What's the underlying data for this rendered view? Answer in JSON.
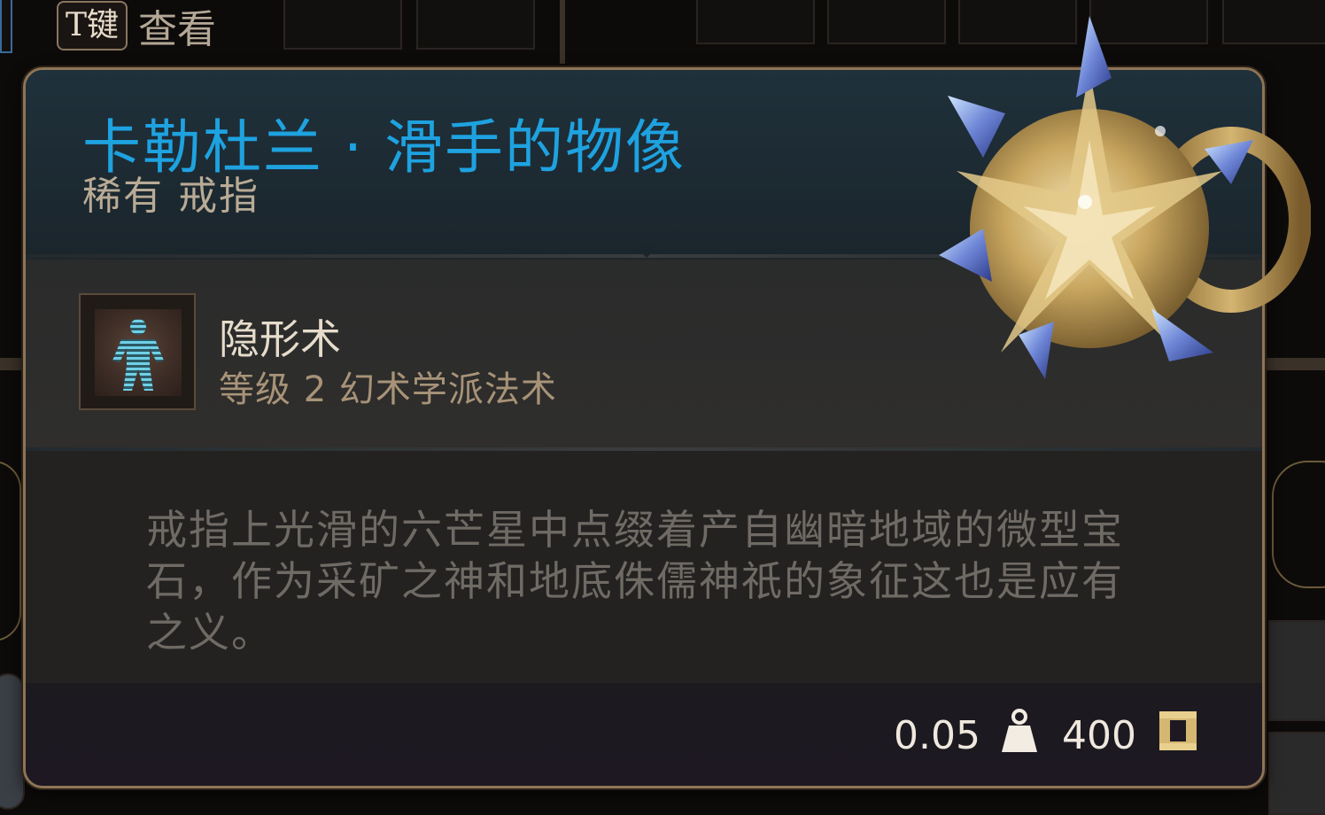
{
  "hint": {
    "key": "T键",
    "action": "查看"
  },
  "item": {
    "name": "卡勒杜兰 · 滑手的物像",
    "rarity_type": "稀有 戒指"
  },
  "spell": {
    "name": "隐形术",
    "description": "等级 2 幻术学派法术",
    "icon": "invisibility-figure-icon"
  },
  "flavor": {
    "text": "戒指上光滑的六芒星中点缀着产自幽暗地域的微型宝石，作为采矿之神和地底侏儒神祇的象征这也是应有之义。"
  },
  "footer": {
    "weight": "0.05",
    "weight_icon": "weight-icon",
    "value": "400",
    "value_icon": "gold-coin-icon"
  },
  "colors": {
    "item_name": "#1ea2e0",
    "border": "#8e7456",
    "spell_desc": "#a89378",
    "gold": "#d6b772"
  }
}
